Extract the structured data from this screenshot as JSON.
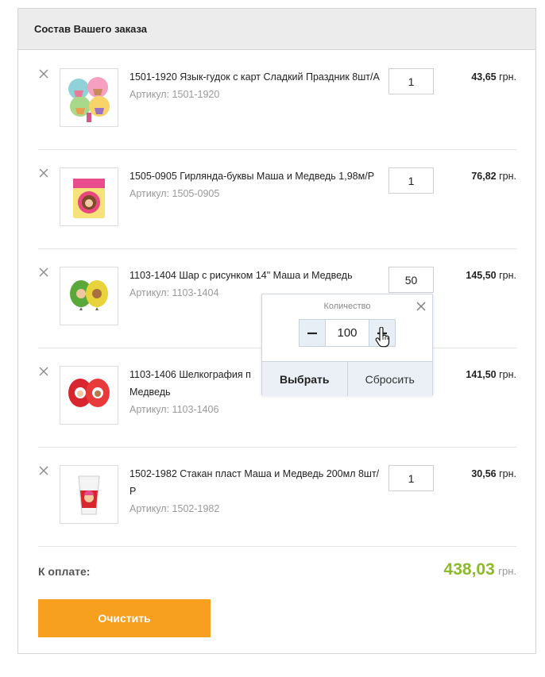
{
  "order": {
    "title": "Состав Вашего заказа",
    "items": [
      {
        "name": "1501-1920 Язык-гудок с карт Сладкий Праздник 8шт/А",
        "sku": "Артикул: 1501-1920",
        "qty": "1",
        "price": "43,65",
        "currency": "грн."
      },
      {
        "name": "1505-0905 Гирлянда-буквы Маша и Медведь 1,98м/Р",
        "sku": "Артикул: 1505-0905",
        "qty": "1",
        "price": "76,82",
        "currency": "грн."
      },
      {
        "name": "1103-1404 Шар с рисунком 14\" Маша и Медведь",
        "sku": "Артикул: 1103-1404",
        "qty": "50",
        "price": "145,50",
        "currency": "грн."
      },
      {
        "name": "1103-1406 Шелкография п",
        "name_cont": "Медведь",
        "sku": "Артикул: 1103-1406",
        "qty": "",
        "price": "141,50",
        "currency": "грн."
      },
      {
        "name": "1502-1982 Стакан пласт Маша и Медведь 200мл 8шт/Р",
        "sku": "Артикул: 1502-1982",
        "qty": "1",
        "price": "30,56",
        "currency": "грн."
      }
    ],
    "total_label": "К оплате:",
    "total_amount": "438,03",
    "total_currency": "грн.",
    "clear_label": "Очистить"
  },
  "qty_popup": {
    "title": "Количество",
    "value": "100",
    "select_label": "Выбрать",
    "reset_label": "Сбросить"
  },
  "colors": {
    "accent_orange": "#f7a020",
    "total_green": "#8cbb27",
    "header_bg": "#ececec",
    "popup_btn_bg": "#eaf0f6"
  },
  "icons": {
    "remove": "close-icon",
    "popup_close": "close-icon",
    "minus": "minus-icon",
    "plus": "plus-icon",
    "cursor": "hand-pointer-icon"
  }
}
